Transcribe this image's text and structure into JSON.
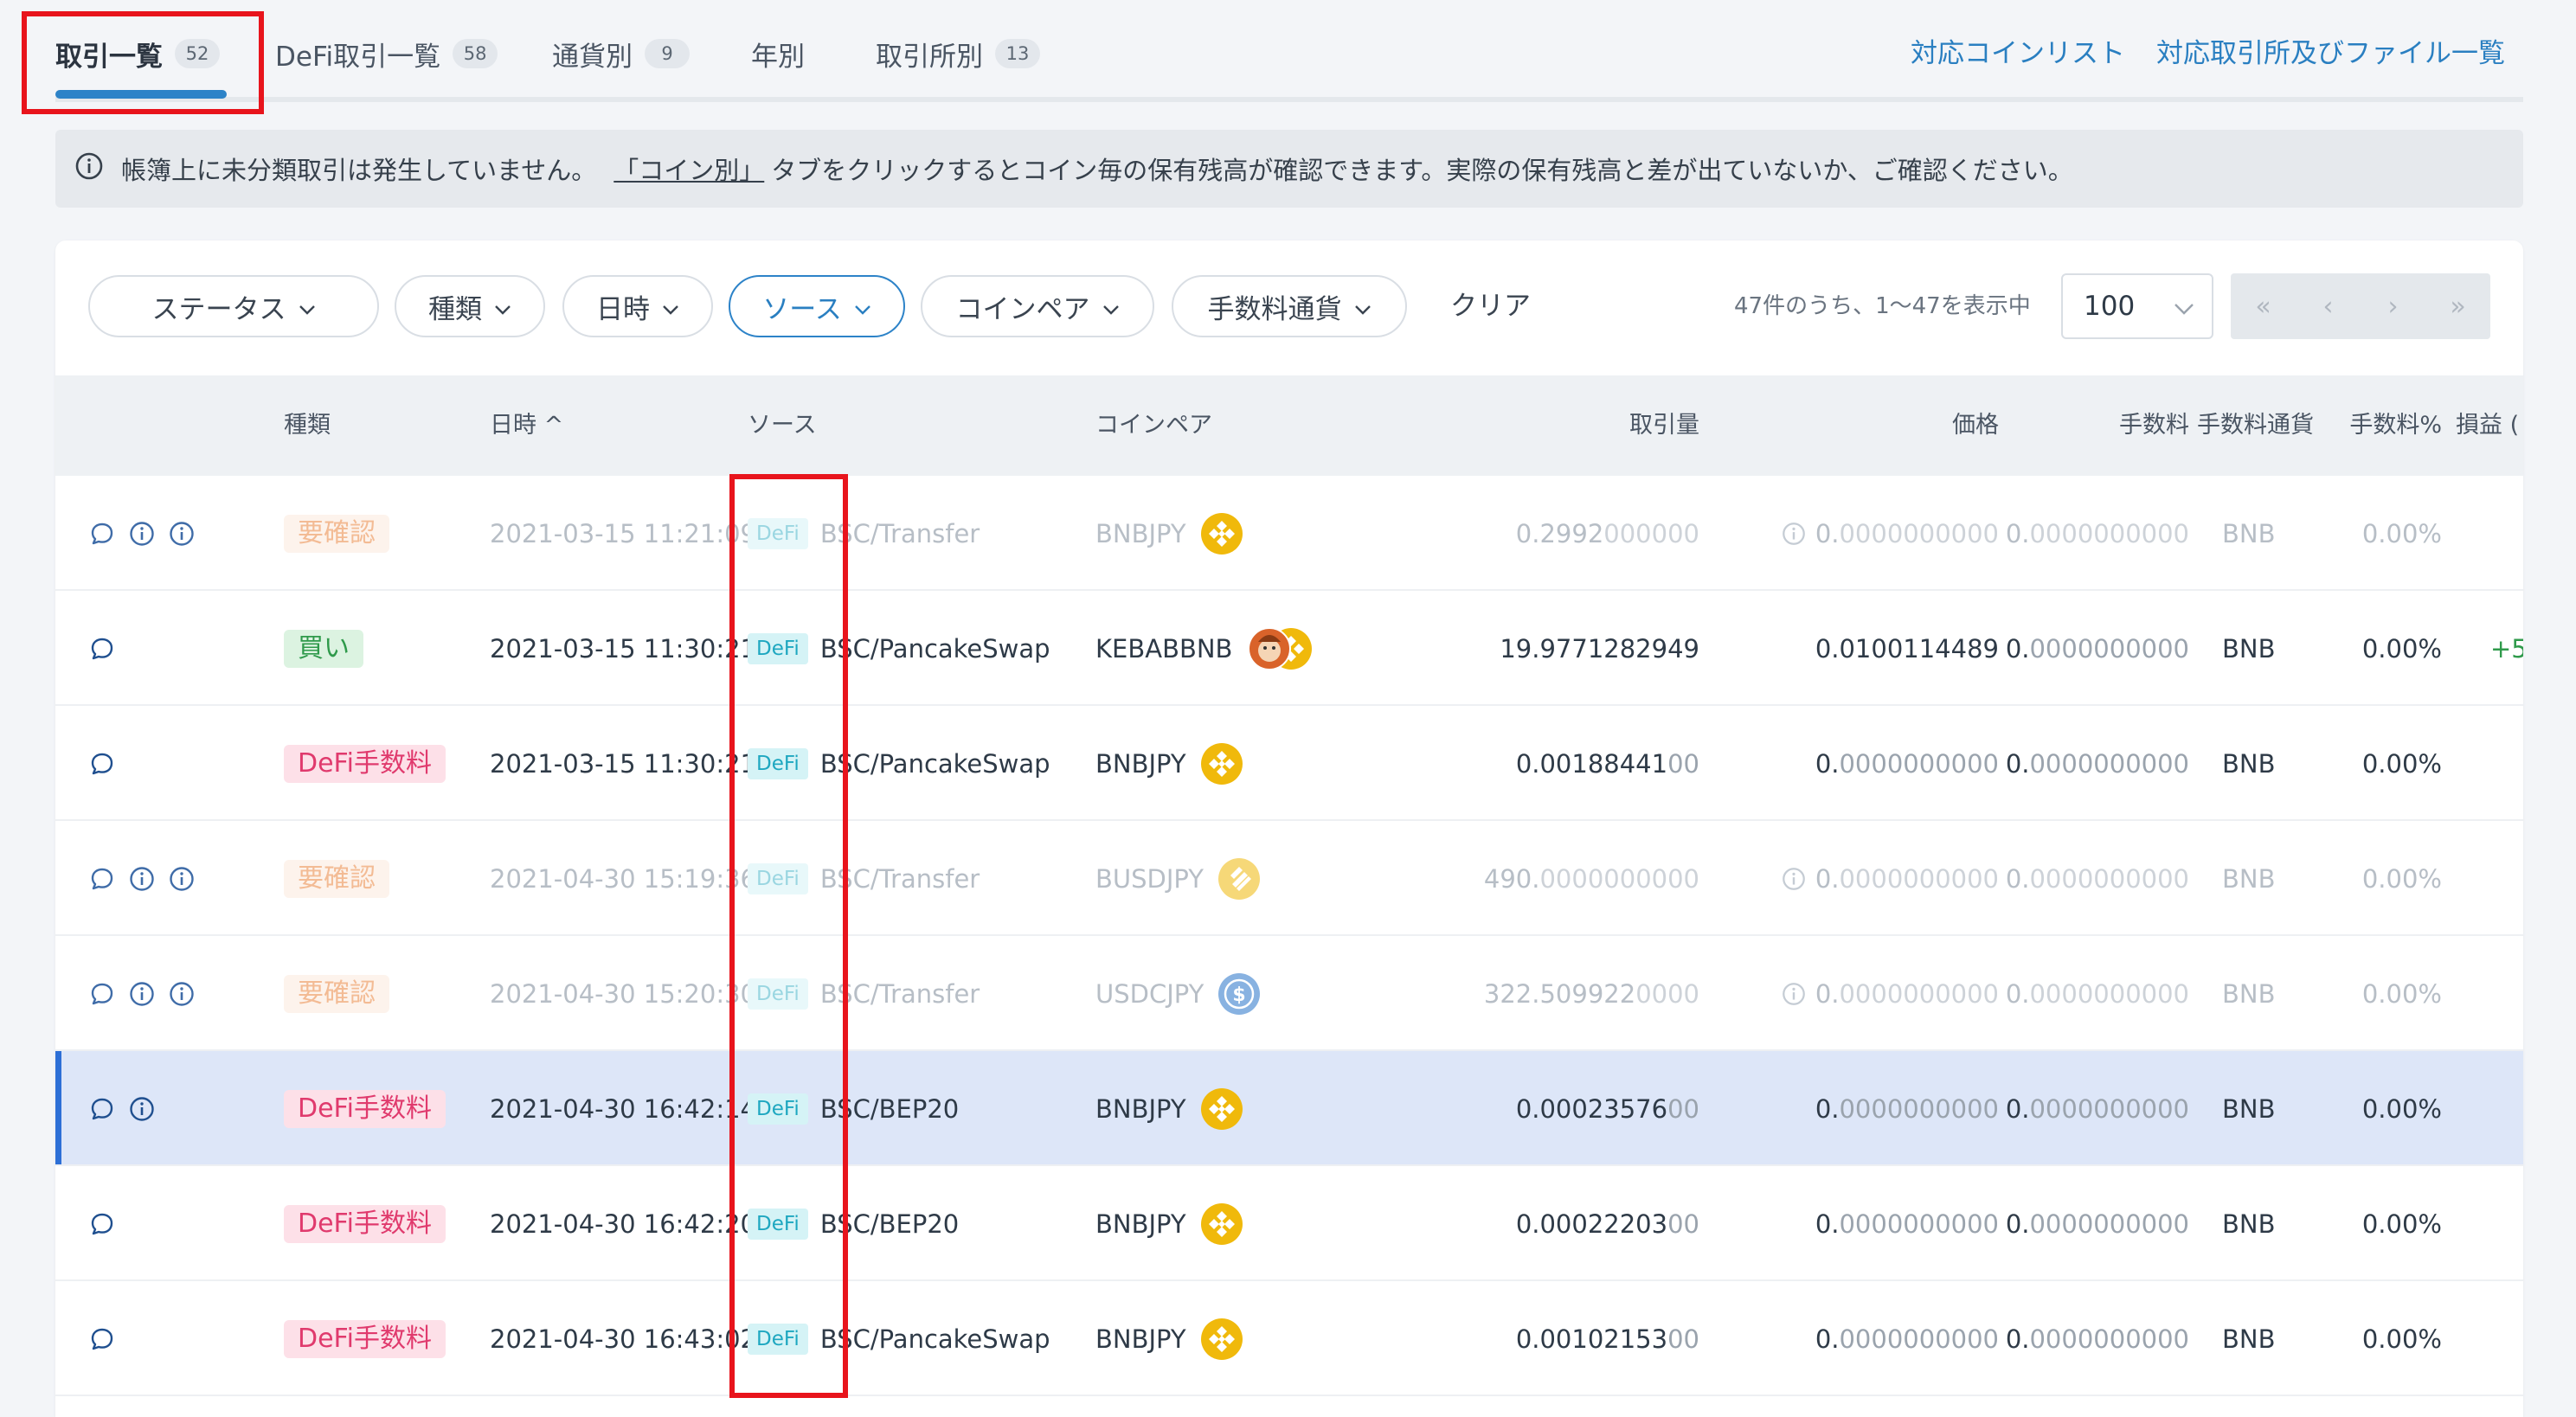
{
  "tabs": [
    {
      "label": "取引一覧",
      "count": "52"
    },
    {
      "label": "DeFi取引一覧",
      "count": "58"
    },
    {
      "label": "通貨別",
      "count": "9"
    },
    {
      "label": "年別",
      "count": ""
    },
    {
      "label": "取引所別",
      "count": "13"
    }
  ],
  "top_links": {
    "coin_list": "対応コインリスト",
    "file_list": "対応取引所及びファイル一覧"
  },
  "notice": {
    "text_before": "帳簿上に未分類取引は発生していません。",
    "link": "「コイン別」",
    "text_after": "タブをクリックするとコイン毎の保有残高が確認できます。実際の保有残高と差が出ていないか、ご確認ください。"
  },
  "filters": {
    "status": "ステータス",
    "type": "種類",
    "datetime": "日時",
    "source": "ソース",
    "coinpair": "コインペア",
    "fee_currency": "手数料通貨",
    "clear": "クリア"
  },
  "pagination": {
    "range_text": "47件のうち、1〜47を表示中",
    "per_page": "100",
    "first": "«",
    "prev": "‹",
    "next": "›",
    "last": "»"
  },
  "table": {
    "headers": {
      "type": "種類",
      "datetime": "日時 ^",
      "source": "ソース",
      "coinpair": "コインペア",
      "amount": "取引量",
      "price": "価格",
      "fee": "手数料",
      "fee_currency": "手数料通貨",
      "fee_pct": "手数料%",
      "pl": "損益 ("
    },
    "rows": [
      {
        "type": "要確認",
        "datetime": "2021-03-15 11:21:09",
        "tag": "DeFi",
        "source": "BSC/Transfer",
        "pair": "BNBJPY",
        "amount_main": "0.2992",
        "amount_tail": "000000",
        "price_main": "0.",
        "price_tail": "0000000000",
        "fee_main": "0.",
        "fee_tail": "0000000000",
        "fee_currency": "BNB",
        "fee_pct": "0.00%",
        "pl": ""
      },
      {
        "type": "買い",
        "datetime": "2021-03-15 11:30:21",
        "tag": "DeFi",
        "source": "BSC/PancakeSwap",
        "pair": "KEBABBNB",
        "amount_main": "19.9771282949",
        "amount_tail": "",
        "price_main": "0.0100114489",
        "price_tail": "",
        "fee_main": "0.",
        "fee_tail": "0000000000",
        "fee_currency": "BNB",
        "fee_pct": "0.00%",
        "pl": "+5"
      },
      {
        "type": "DeFi手数料",
        "datetime": "2021-03-15 11:30:21",
        "tag": "DeFi",
        "source": "BSC/PancakeSwap",
        "pair": "BNBJPY",
        "amount_main": "0.00188441",
        "amount_tail": "00",
        "price_main": "0.",
        "price_tail": "0000000000",
        "fee_main": "0.",
        "fee_tail": "0000000000",
        "fee_currency": "BNB",
        "fee_pct": "0.00%",
        "pl": ""
      },
      {
        "type": "要確認",
        "datetime": "2021-04-30 15:19:36",
        "tag": "DeFi",
        "source": "BSC/Transfer",
        "pair": "BUSDJPY",
        "amount_main": "490.",
        "amount_tail": "0000000000",
        "price_main": "0.",
        "price_tail": "0000000000",
        "fee_main": "0.",
        "fee_tail": "0000000000",
        "fee_currency": "BNB",
        "fee_pct": "0.00%",
        "pl": ""
      },
      {
        "type": "要確認",
        "datetime": "2021-04-30 15:20:30",
        "tag": "DeFi",
        "source": "BSC/Transfer",
        "pair": "USDCJPY",
        "amount_main": "322.509922",
        "amount_tail": "0000",
        "price_main": "0.",
        "price_tail": "0000000000",
        "fee_main": "0.",
        "fee_tail": "0000000000",
        "fee_currency": "BNB",
        "fee_pct": "0.00%",
        "pl": ""
      },
      {
        "type": "DeFi手数料",
        "datetime": "2021-04-30 16:42:14",
        "tag": "DeFi",
        "source": "BSC/BEP20",
        "pair": "BNBJPY",
        "amount_main": "0.00023576",
        "amount_tail": "00",
        "price_main": "0.",
        "price_tail": "0000000000",
        "fee_main": "0.",
        "fee_tail": "0000000000",
        "fee_currency": "BNB",
        "fee_pct": "0.00%",
        "pl": ""
      },
      {
        "type": "DeFi手数料",
        "datetime": "2021-04-30 16:42:20",
        "tag": "DeFi",
        "source": "BSC/BEP20",
        "pair": "BNBJPY",
        "amount_main": "0.00022203",
        "amount_tail": "00",
        "price_main": "0.",
        "price_tail": "0000000000",
        "fee_main": "0.",
        "fee_tail": "0000000000",
        "fee_currency": "BNB",
        "fee_pct": "0.00%",
        "pl": ""
      },
      {
        "type": "DeFi手数料",
        "datetime": "2021-04-30 16:43:02",
        "tag": "DeFi",
        "source": "BSC/PancakeSwap",
        "pair": "BNBJPY",
        "amount_main": "0.00102153",
        "amount_tail": "00",
        "price_main": "0.",
        "price_tail": "0000000000",
        "fee_main": "0.",
        "fee_tail": "0000000000",
        "fee_currency": "BNB",
        "fee_pct": "0.00%",
        "pl": ""
      }
    ]
  },
  "colors": {
    "accent": "#2d83c8",
    "annotation_red": "#e8141c",
    "selected_row": "#dde6f8",
    "bnb_coin": "#f0b90b",
    "usdc_coin": "#2775ca"
  }
}
